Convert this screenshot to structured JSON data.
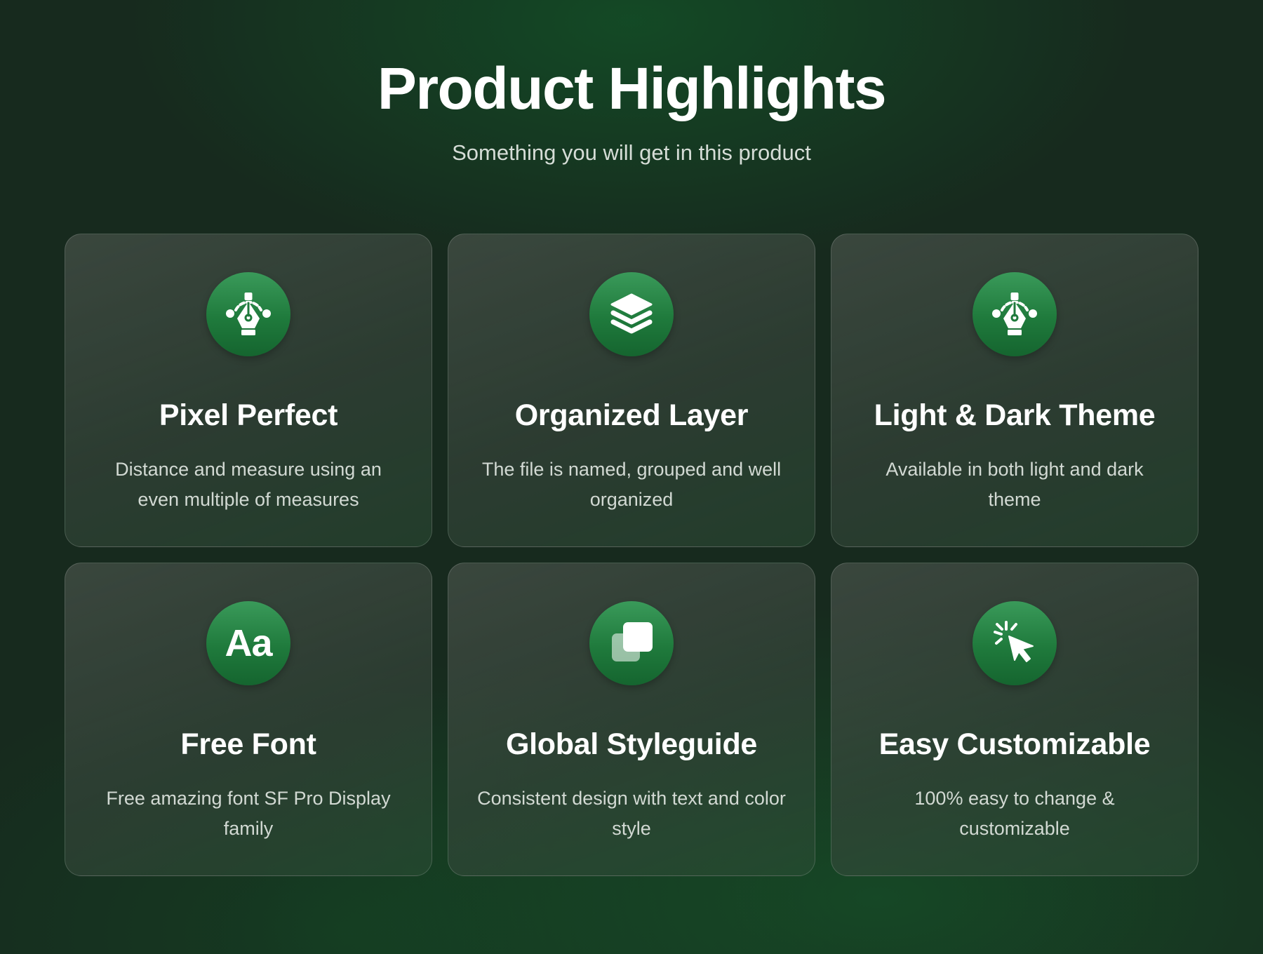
{
  "header": {
    "title": "Product Highlights",
    "subtitle": "Something you will get in this product"
  },
  "features": [
    {
      "icon": "pen-tool-icon",
      "title": "Pixel Perfect",
      "description": "Distance and measure using an even multiple of measures"
    },
    {
      "icon": "layers-icon",
      "title": "Organized Layer",
      "description": "The file is named, grouped and well organized"
    },
    {
      "icon": "pen-tool-icon",
      "title": "Light & Dark Theme",
      "description": "Available in both light and dark theme"
    },
    {
      "icon": "font-icon",
      "icon_text": "Aa",
      "title": "Free Font",
      "description": "Free amazing font SF Pro Display family"
    },
    {
      "icon": "styleguide-icon",
      "title": "Global Styleguide",
      "description": "Consistent design with text and color style"
    },
    {
      "icon": "cursor-click-icon",
      "title": "Easy Customizable",
      "description": "100% easy to change & customizable"
    }
  ],
  "colors": {
    "background": "#172a1e",
    "accent_green": "#1f7a3c",
    "text_primary": "#ffffff",
    "text_secondary": "#d2d9d3"
  }
}
